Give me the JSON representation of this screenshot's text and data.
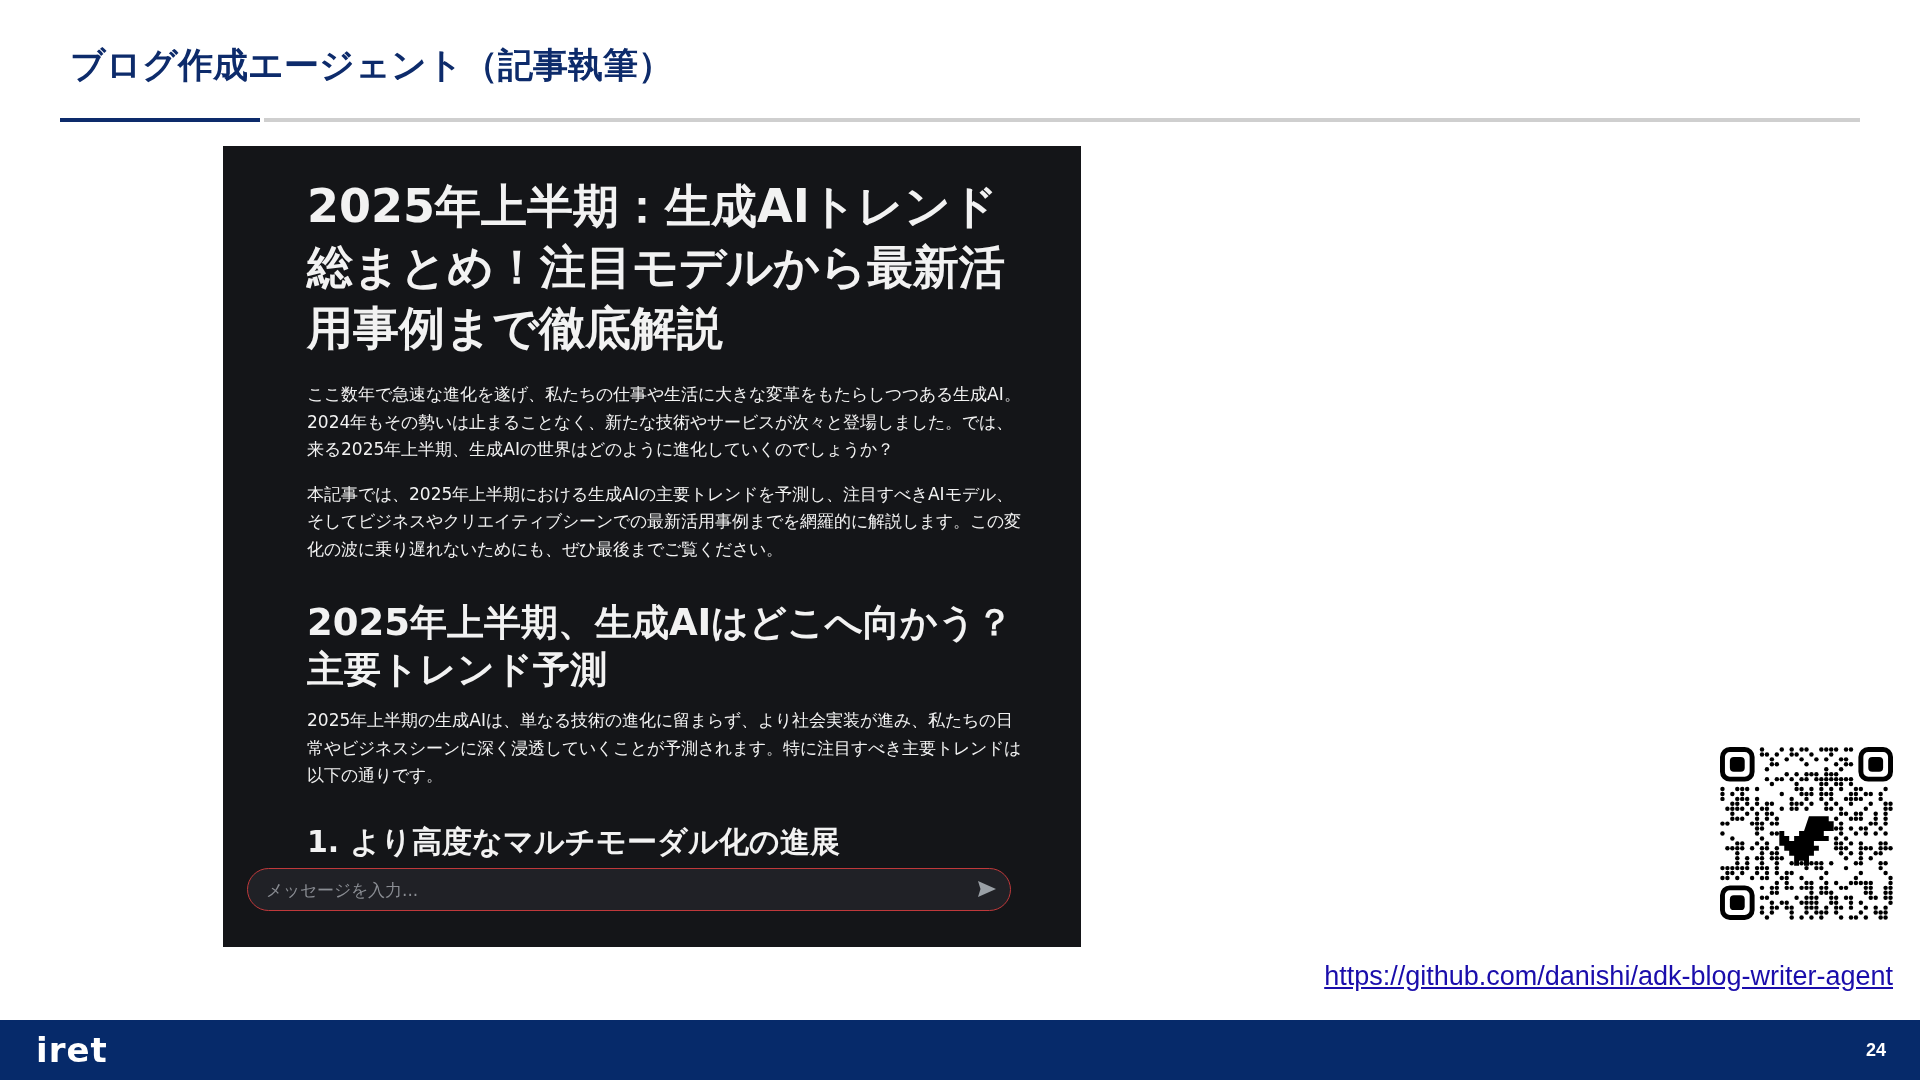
{
  "slide": {
    "title": "ブログ作成エージェント（記事執筆）",
    "link": "https://github.com/danishi/adk-blog-writer-agent",
    "logo": "iret",
    "page_number": "24"
  },
  "chat_screenshot": {
    "blocks": [
      {
        "kind": "h1",
        "text": "2025年上半期：生成AIトレンド総まとめ！注目モデルから最新活用事例まで徹底解説"
      },
      {
        "kind": "p",
        "text": "ここ数年で急速な進化を遂げ、私たちの仕事や生活に大きな変革をもたらしつつある生成AI。2024年もその勢いは止まることなく、新たな技術やサービスが次々と登場しました。では、来る2025年上半期、生成AIの世界はどのように進化していくのでしょうか？"
      },
      {
        "kind": "p",
        "text": "本記事では、2025年上半期における生成AIの主要トレンドを予測し、注目すべきAIモデル、そしてビジネスやクリエイティブシーンでの最新活用事例までを網羅的に解説します。この変化の波に乗り遅れないためにも、ぜひ最後までご覧ください。"
      },
      {
        "kind": "h2",
        "text": "2025年上半期、生成AIはどこへ向かう？主要トレンド予測"
      },
      {
        "kind": "p",
        "text": "2025年上半期の生成AIは、単なる技術の進化に留まらず、より社会実装が進み、私たちの日常やビジネスシーンに深く浸透していくことが予測されます。特に注目すべき主要トレンドは以下の通りです。"
      },
      {
        "kind": "h3",
        "text": "1. より高度なマルチモーダル化の進展"
      }
    ],
    "input": {
      "placeholder": "メッセージを入力..."
    }
  }
}
